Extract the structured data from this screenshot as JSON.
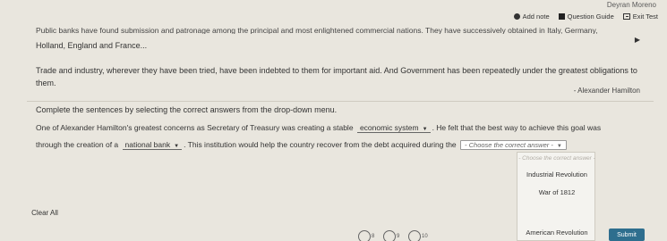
{
  "header": {
    "user_name": "Deyran Moreno",
    "actions": [
      "Add note",
      "Question Guide",
      "Exit Test"
    ]
  },
  "passage": {
    "cut_line": "Public banks have found submission and patronage among the principal and most enlightened commercial nations. They have successively obtained in Italy, Germany,",
    "line_1": "Holland, England and France...",
    "para_2": "Trade and industry, wherever they have been tried, have been indebted to them for important aid. And Government has been repeatedly under the greatest obligations to them.",
    "attribution": "- Alexander Hamilton"
  },
  "instructions": "Complete the sentences by selecting the correct answers from the drop-down menu.",
  "question": {
    "part_1": "One of Alexander Hamilton's greatest concerns as Secretary of Treasury was creating a stable",
    "dropdown_1": "economic system",
    "part_2": ". He felt that the best way to achieve this goal was",
    "part_3": "through the creation of a",
    "dropdown_2": "national bank",
    "part_4": ". This institution would help the country recover from the debt acquired during the",
    "dropdown_3_placeholder": "- Choose the correct answer -"
  },
  "menu": {
    "placeholder": "- Choose the correct answer -",
    "options": [
      "Industrial Revolution",
      "War of 1812",
      "American Revolution"
    ]
  },
  "buttons": {
    "clear": "Clear All",
    "submit": "Submit"
  },
  "navigation": {
    "numbers": [
      "8",
      "9",
      "10"
    ]
  }
}
